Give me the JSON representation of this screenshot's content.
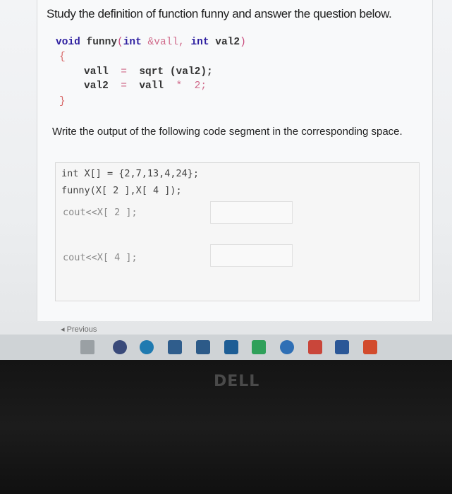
{
  "question": {
    "title": "Study the definition of function funny and answer the question below."
  },
  "function_code": {
    "line1_kw1": "void",
    "line1_name": "funny",
    "line1_paren_open": "(",
    "line1_kw2": "int",
    "line1_param1": "&vall,",
    "line1_kw3": "int",
    "line1_param2": "val2",
    "line1_paren_close": ")",
    "open_brace": "{",
    "line3_lhs": "vall",
    "line3_eq": "=",
    "line3_rhs": "sqrt",
    "line3_args": "(val2);",
    "line4_lhs": "val2",
    "line4_eq": "=",
    "line4_rhs": "vall",
    "line4_op": "*",
    "line4_tail": "2;",
    "close_brace": "}"
  },
  "prompt": {
    "text": "Write the output of the following code segment in the corresponding space."
  },
  "segment": {
    "line1": "int X[] = {2,7,13,4,24};",
    "line2": "funny(X[ 2 ],X[ 4 ]);",
    "line3": "cout<<X[ 2 ];",
    "line4": "cout<<X[ 4 ];"
  },
  "navigation": {
    "previous_label": "Previous",
    "previous_arrow": "◂"
  },
  "taskbar": {
    "icons": [
      "task-view-icon",
      "firefox-icon",
      "edge-icon",
      "explorer-icon",
      "store-icon",
      "mail-icon",
      "chevron-app-icon",
      "chrome-icon",
      "acrobat-icon",
      "word-icon",
      "office-icon"
    ]
  },
  "monitor": {
    "brand": "DELL"
  }
}
